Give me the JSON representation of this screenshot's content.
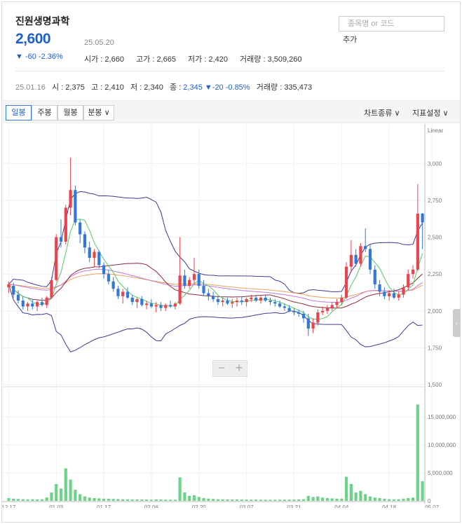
{
  "stock": {
    "name": "진원생명과학",
    "price": "2,600",
    "date": "25.05.20",
    "change": "▼ -60 -2.36%",
    "open_label": "시가",
    "open": "2,660",
    "high_label": "고가",
    "high": "2,665",
    "low_label": "저가",
    "low": "2,420",
    "volume_label": "거래량",
    "volume": "3,509,260"
  },
  "search": {
    "placeholder": "종목명 or 코드",
    "add_label": "추가"
  },
  "hover": {
    "date": "25.01.16",
    "open_label": "시",
    "open": "2,375",
    "high_label": "고",
    "high": "2,410",
    "low_label": "저",
    "low": "2,340",
    "close_label": "종",
    "close": "2,345",
    "change": "▼-20 -0.85%",
    "volume_label": "거래량",
    "volume": "335,473"
  },
  "toolbar": {
    "tabs": [
      "일봉",
      "주봉",
      "월봉",
      "분봉 ∨"
    ],
    "active_tab": "일봉",
    "chart_type": "차트종류 ∨",
    "indicator": "지표설정 ∨"
  },
  "zoom": {
    "minus": "−",
    "plus": "+"
  },
  "colors": {
    "up": "#e8434f",
    "down": "#3478d6",
    "volume": "#6fd28a",
    "accent": "#1f5fc8"
  },
  "chart_data": {
    "type": "candlestick",
    "scale_label": "Linear",
    "price_ticks": [
      "3,000",
      "2,750",
      "2,500",
      "2,250",
      "2,000",
      "1,750",
      "1,500"
    ],
    "price_tick_values": [
      3000,
      2750,
      2500,
      2250,
      2000,
      1750,
      1500
    ],
    "volume_ticks": [
      "15,000,000",
      "10,000,000",
      "5,000,000",
      "0"
    ],
    "volume_tick_values": [
      15000000,
      10000000,
      5000000,
      0
    ],
    "x_labels": [
      "12.17",
      "01.03",
      "01.17",
      "02.06",
      "02.20",
      "03.07",
      "03.21",
      "04.04",
      "04.18",
      "05.07"
    ],
    "x_label_index": [
      0,
      10,
      20,
      30,
      40,
      50,
      60,
      70,
      80,
      89
    ],
    "ohlcv": [
      [
        2160,
        2200,
        2120,
        2180,
        500000
      ],
      [
        2170,
        2190,
        2090,
        2110,
        400000
      ],
      [
        2110,
        2140,
        2050,
        2070,
        350000
      ],
      [
        2070,
        2100,
        2010,
        2030,
        300000
      ],
      [
        2030,
        2060,
        2000,
        2050,
        280000
      ],
      [
        2050,
        2080,
        2010,
        2030,
        300000
      ],
      [
        2030,
        2070,
        2000,
        2060,
        250000
      ],
      [
        2060,
        2090,
        2030,
        2040,
        300000
      ],
      [
        2040,
        2100,
        2020,
        2090,
        600000
      ],
      [
        2090,
        2230,
        2080,
        2210,
        1500000
      ],
      [
        2210,
        2520,
        2200,
        2500,
        3000000
      ],
      [
        2500,
        2620,
        2430,
        2470,
        2200000
      ],
      [
        2470,
        2720,
        2450,
        2700,
        5800000
      ],
      [
        2700,
        3040,
        2650,
        2820,
        3800000
      ],
      [
        2820,
        2850,
        2580,
        2600,
        2000000
      ],
      [
        2600,
        2620,
        2460,
        2520,
        1200000
      ],
      [
        2520,
        2540,
        2390,
        2430,
        800000
      ],
      [
        2430,
        2470,
        2330,
        2360,
        600000
      ],
      [
        2360,
        2420,
        2300,
        2400,
        500000
      ],
      [
        2400,
        2410,
        2290,
        2310,
        450000
      ],
      [
        2310,
        2330,
        2220,
        2250,
        400000
      ],
      [
        2250,
        2280,
        2180,
        2200,
        380000
      ],
      [
        2200,
        2230,
        2130,
        2150,
        350000
      ],
      [
        2150,
        2170,
        2080,
        2100,
        330000
      ],
      [
        2100,
        2150,
        2050,
        2130,
        300000
      ],
      [
        2130,
        2160,
        2080,
        2090,
        280000
      ],
      [
        2090,
        2110,
        2040,
        2060,
        260000
      ],
      [
        2060,
        2090,
        2020,
        2080,
        250000
      ],
      [
        2080,
        2100,
        2030,
        2040,
        240000
      ],
      [
        2040,
        2070,
        2010,
        2050,
        230000
      ],
      [
        2050,
        2080,
        2020,
        2030,
        220000
      ],
      [
        2030,
        2060,
        1990,
        2040,
        250000
      ],
      [
        2040,
        2060,
        2000,
        2020,
        240000
      ],
      [
        2020,
        2050,
        2000,
        2040,
        230000
      ],
      [
        2040,
        2070,
        2020,
        2030,
        220000
      ],
      [
        2030,
        2060,
        2010,
        2050,
        210000
      ],
      [
        2050,
        2500,
        2040,
        2240,
        4200000
      ],
      [
        2240,
        2280,
        2150,
        2170,
        1500000
      ],
      [
        2170,
        2230,
        2150,
        2210,
        900000
      ],
      [
        2210,
        2360,
        2180,
        2250,
        1000000
      ],
      [
        2250,
        2280,
        2150,
        2170,
        700000
      ],
      [
        2170,
        2210,
        2100,
        2120,
        500000
      ],
      [
        2120,
        2150,
        2070,
        2100,
        400000
      ],
      [
        2100,
        2130,
        2060,
        2080,
        350000
      ],
      [
        2080,
        2100,
        2040,
        2060,
        300000
      ],
      [
        2060,
        2090,
        2030,
        2070,
        280000
      ],
      [
        2070,
        2090,
        2040,
        2050,
        270000
      ],
      [
        2050,
        2080,
        2020,
        2060,
        260000
      ],
      [
        2060,
        2090,
        2030,
        2070,
        250000
      ],
      [
        2070,
        2100,
        2040,
        2060,
        240000
      ],
      [
        2060,
        2090,
        2030,
        2080,
        230000
      ],
      [
        2080,
        2110,
        2060,
        2090,
        220000
      ],
      [
        2090,
        2110,
        2060,
        2070,
        230000
      ],
      [
        2070,
        2100,
        2050,
        2090,
        220000
      ],
      [
        2090,
        2110,
        2060,
        2070,
        210000
      ],
      [
        2070,
        2090,
        2040,
        2060,
        200000
      ],
      [
        2060,
        2080,
        2030,
        2050,
        200000
      ],
      [
        2050,
        2070,
        2020,
        2030,
        210000
      ],
      [
        2030,
        2050,
        2000,
        2020,
        220000
      ],
      [
        2020,
        2040,
        1990,
        2000,
        230000
      ],
      [
        2000,
        2020,
        1970,
        1990,
        240000
      ],
      [
        1990,
        2010,
        1960,
        1980,
        250000
      ],
      [
        1980,
        2000,
        1920,
        1950,
        300000
      ],
      [
        1950,
        1980,
        1830,
        1880,
        900000
      ],
      [
        1880,
        1950,
        1850,
        1920,
        700000
      ],
      [
        1920,
        2010,
        1900,
        1990,
        800000
      ],
      [
        1990,
        2030,
        1970,
        2000,
        600000
      ],
      [
        2000,
        2040,
        1980,
        2020,
        500000
      ],
      [
        2020,
        2060,
        2000,
        2040,
        450000
      ],
      [
        2040,
        2080,
        2020,
        2060,
        400000
      ],
      [
        2060,
        2110,
        2040,
        2090,
        420000
      ],
      [
        2090,
        2330,
        2080,
        2300,
        4300000
      ],
      [
        2300,
        2480,
        2260,
        2380,
        3000000
      ],
      [
        2380,
        2420,
        2300,
        2320,
        1500000
      ],
      [
        2320,
        2460,
        2300,
        2440,
        1800000
      ],
      [
        2440,
        2560,
        2400,
        2420,
        1200000
      ],
      [
        2420,
        2450,
        2250,
        2280,
        800000
      ],
      [
        2280,
        2310,
        2150,
        2180,
        600000
      ],
      [
        2180,
        2210,
        2100,
        2130,
        500000
      ],
      [
        2130,
        2160,
        2080,
        2100,
        400000
      ],
      [
        2100,
        2140,
        2070,
        2120,
        300000
      ],
      [
        2120,
        2150,
        2080,
        2090,
        280000
      ],
      [
        2090,
        2130,
        2070,
        2110,
        300000
      ],
      [
        2110,
        2180,
        2090,
        2160,
        400000
      ],
      [
        2160,
        2280,
        2140,
        2250,
        500000
      ],
      [
        2250,
        2310,
        2220,
        2280,
        600000
      ],
      [
        2280,
        2860,
        2270,
        2660,
        17200000
      ],
      [
        2660,
        2665,
        2420,
        2600,
        3509260
      ]
    ]
  }
}
